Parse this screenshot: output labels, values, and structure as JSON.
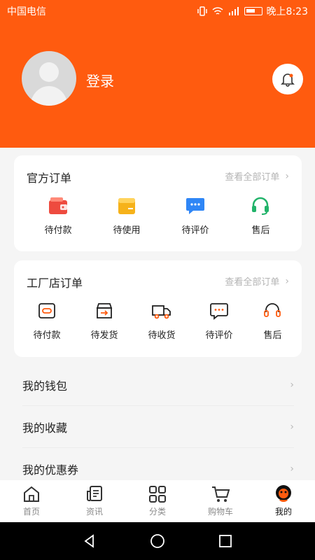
{
  "status_bar": {
    "carrier": "中国电信",
    "time": "晚上8:23"
  },
  "profile": {
    "login_label": "登录"
  },
  "official_orders": {
    "title": "官方订单",
    "view_all": "查看全部订单",
    "items": [
      {
        "label": "待付款",
        "icon": "wallet-icon"
      },
      {
        "label": "待使用",
        "icon": "package-icon"
      },
      {
        "label": "待评价",
        "icon": "chat-icon"
      },
      {
        "label": "售后",
        "icon": "headset-icon"
      }
    ]
  },
  "factory_orders": {
    "title": "工厂店订单",
    "view_all": "查看全部订单",
    "items": [
      {
        "label": "待付款",
        "icon": "wallet-outline-icon"
      },
      {
        "label": "待发货",
        "icon": "box-arrow-icon"
      },
      {
        "label": "待收货",
        "icon": "truck-icon"
      },
      {
        "label": "待评价",
        "icon": "chat-outline-icon"
      },
      {
        "label": "售后",
        "icon": "headset-outline-icon"
      }
    ]
  },
  "menu": {
    "items": [
      {
        "label": "我的钱包"
      },
      {
        "label": "我的收藏"
      },
      {
        "label": "我的优惠券"
      }
    ]
  },
  "tabbar": {
    "items": [
      {
        "label": "首页",
        "icon": "home-icon"
      },
      {
        "label": "资讯",
        "icon": "news-icon"
      },
      {
        "label": "分类",
        "icon": "grid-icon"
      },
      {
        "label": "购物车",
        "icon": "cart-icon"
      },
      {
        "label": "我的",
        "icon": "profile-icon"
      }
    ],
    "active_index": 4
  },
  "colors": {
    "brand": "#ff5b0f",
    "wallet_red": "#ee4b3f",
    "package_yellow": "#f6b21a",
    "chat_blue": "#2f86f6",
    "headset_green": "#22b36a"
  }
}
